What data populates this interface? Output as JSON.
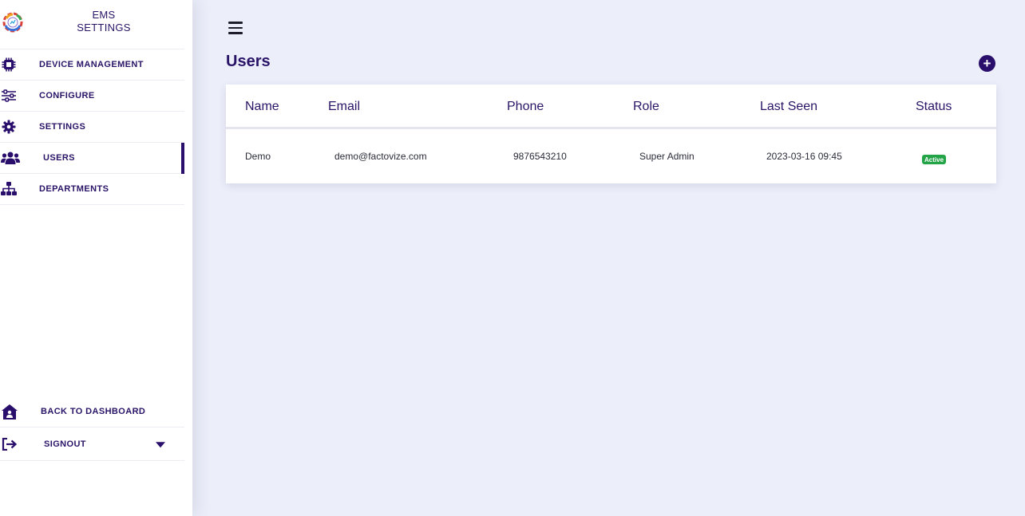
{
  "sidebar": {
    "brand_line1": "EMS",
    "brand_line2": "SETTINGS",
    "items": [
      {
        "label": "DEVICE MANAGEMENT",
        "icon": "chip-icon"
      },
      {
        "label": "CONFIGURE",
        "icon": "sliders-icon"
      },
      {
        "label": "SETTINGS",
        "icon": "gear-icon"
      },
      {
        "label": "USERS",
        "icon": "users-icon",
        "active": true
      },
      {
        "label": "DEPARTMENTS",
        "icon": "sitemap-icon"
      }
    ],
    "bottom_items": [
      {
        "label": "BACK TO DASHBOARD",
        "icon": "house-user-icon"
      },
      {
        "label": "SIGNOUT",
        "icon": "sign-out-icon"
      }
    ]
  },
  "main": {
    "title": "Users",
    "add_icon": "plus-circle-icon",
    "table": {
      "headers": [
        "Name",
        "Email",
        "Phone",
        "Role",
        "Last Seen",
        "Status"
      ],
      "rows": [
        {
          "name": "Demo",
          "email": "demo@factovize.com",
          "phone": "9876543210",
          "role": "Super Admin",
          "last_seen": "2023-03-16 09:45",
          "status": "Active"
        }
      ]
    }
  },
  "colors": {
    "accent": "#2a0e6b",
    "text": "#2a1468",
    "background": "#eceffa",
    "status_active": "#22a447"
  }
}
